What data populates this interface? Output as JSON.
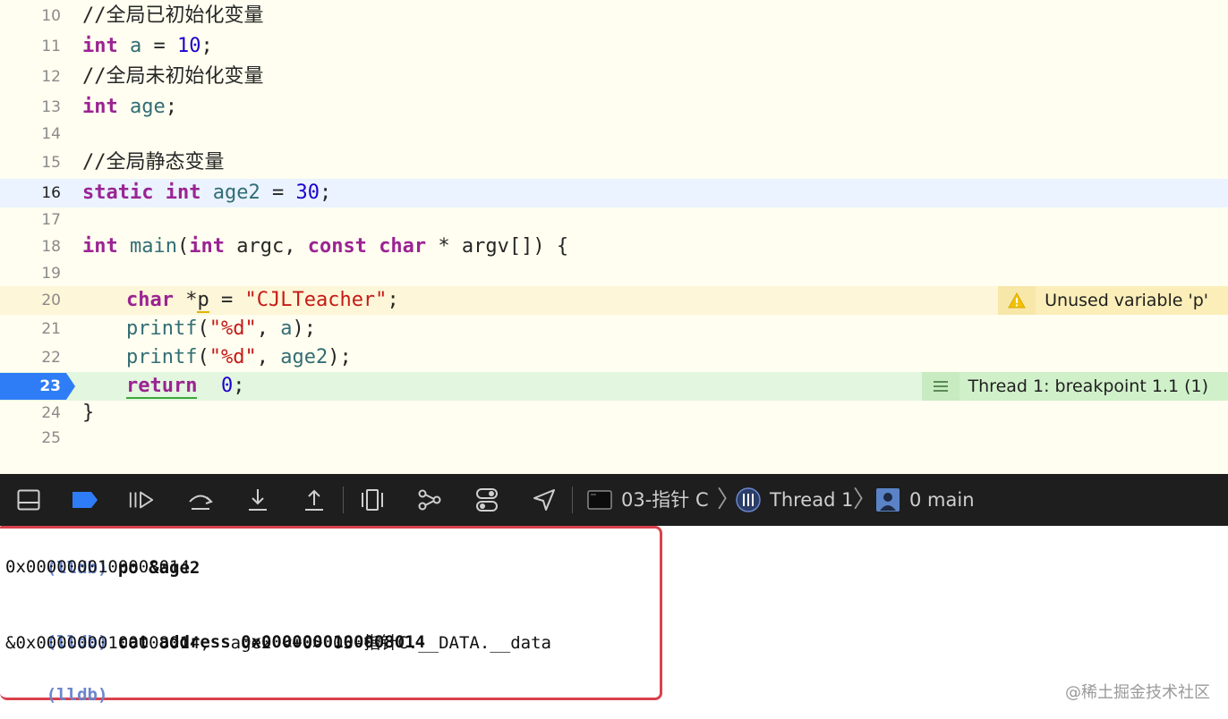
{
  "editor": {
    "lines": [
      {
        "num": "10",
        "text": "//全局已初始化变量"
      },
      {
        "num": "11",
        "text": "int a = 10;"
      },
      {
        "num": "12",
        "text": "//全局未初始化变量"
      },
      {
        "num": "13",
        "text": "int age;"
      },
      {
        "num": "14",
        "text": ""
      },
      {
        "num": "15",
        "text": "//全局静态变量"
      },
      {
        "num": "16",
        "text": "static int age2 = 30;"
      },
      {
        "num": "17",
        "text": ""
      },
      {
        "num": "18",
        "text": "int main(int argc, const char * argv[]) {"
      },
      {
        "num": "19",
        "text": ""
      },
      {
        "num": "20",
        "text": "char *p = \"CJLTeacher\";"
      },
      {
        "num": "21",
        "text": "printf(\"%d\", a);"
      },
      {
        "num": "22",
        "text": "printf(\"%d\", age2);"
      },
      {
        "num": "23",
        "text": "return  0;"
      },
      {
        "num": "24",
        "text": "}"
      },
      {
        "num": "25",
        "text": ""
      }
    ],
    "warning_annotation": "Unused variable 'p'",
    "breakpoint_annotation": "Thread 1: breakpoint 1.1 (1)"
  },
  "debugbar": {
    "target": "03-指针 C",
    "thread": "Thread 1",
    "frame": "0 main",
    "icons": [
      "toggle-console-icon",
      "breakpoints-toggle-icon",
      "continue-icon",
      "step-over-icon",
      "step-into-icon",
      "step-out-icon",
      "view-hierarchy-icon",
      "memory-graph-icon",
      "environment-overrides-icon",
      "simulate-location-icon"
    ]
  },
  "console": {
    "lines": [
      {
        "prompt": "(lldb)",
        "text": " po &age2"
      },
      {
        "prompt": "",
        "text": "0x0000000100008014"
      },
      {
        "prompt": "",
        "text": ""
      },
      {
        "prompt": "(lldb)",
        "text": " cat address 0x0000000100008014"
      },
      {
        "prompt": "",
        "text": "&0x0000000100008014,  age2 <+0> 03-指针C.__DATA.__data"
      },
      {
        "prompt": "(lldb)",
        "text": ""
      }
    ]
  },
  "watermark": "@稀土掘金技术社区",
  "colors": {
    "editor_bg": "#fffef0",
    "current_line": "#eaf3ff",
    "warning_line": "#fdf6d8",
    "breakpoint_line": "#e3f6df",
    "breakpoint_marker": "#2f7df6",
    "keyword": "#9b2393",
    "comment": "#3d7c1c",
    "string": "#c41a16",
    "number": "#1c00cf",
    "console_border": "#d9414c",
    "lldb_prompt": "#6a86cf"
  }
}
